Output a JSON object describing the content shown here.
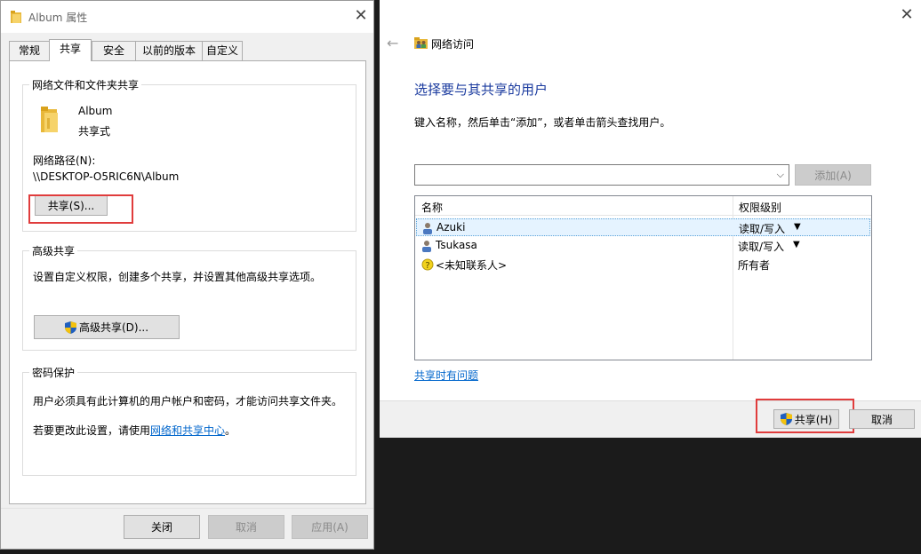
{
  "props": {
    "title": "Album 属性",
    "tabs": [
      "常规",
      "共享",
      "安全",
      "以前的版本",
      "自定义"
    ],
    "active_tab": "共享",
    "network_group": {
      "label": "网络文件和文件夹共享",
      "folder_name": "Album",
      "share_status": "共享式",
      "path_label": "网络路径(N):",
      "path_value": "\\\\DESKTOP-O5RIC6N\\Album",
      "share_button": "共享(S)..."
    },
    "advanced_group": {
      "label": "高级共享",
      "description": "设置自定义权限，创建多个共享，并设置其他高级共享选项。",
      "button": "高级共享(D)..."
    },
    "password_group": {
      "label": "密码保护",
      "line1": "用户必须具有此计算机的用户帐户和密码，才能访问共享文件夹。",
      "line2_prefix": "若要更改此设置，请使用",
      "line2_link": "网络和共享中心",
      "line2_suffix": "。"
    },
    "footer": {
      "close": "关闭",
      "cancel": "取消",
      "apply": "应用(A)"
    }
  },
  "net": {
    "title": "网络访问",
    "heading": "选择要与其共享的用户",
    "instruction": "键入名称，然后单击“添加”，或者单击箭头查找用户。",
    "name_input_value": "",
    "add_button": "添加(A)",
    "columns": {
      "name": "名称",
      "permission": "权限级别"
    },
    "users": [
      {
        "name": "Azuki",
        "permission": "读取/写入",
        "selected": true
      },
      {
        "name": "Tsukasa",
        "permission": "读取/写入",
        "selected": false
      },
      {
        "name": "<未知联系人>",
        "permission": "所有者",
        "selected": false
      }
    ],
    "help_link": "共享时有问题",
    "footer": {
      "share": "共享(H)",
      "cancel": "取消"
    }
  },
  "colors": {
    "accent": "#1b3b9f",
    "link": "#0066cc",
    "highlight": "#e03c3c",
    "selection": "#e5f3ff"
  },
  "icons": [
    "folder-icon",
    "close-icon",
    "back-arrow-icon",
    "network-users-icon",
    "user-icon",
    "unknown-contact-icon",
    "shield-icon",
    "chevron-down-icon"
  ]
}
